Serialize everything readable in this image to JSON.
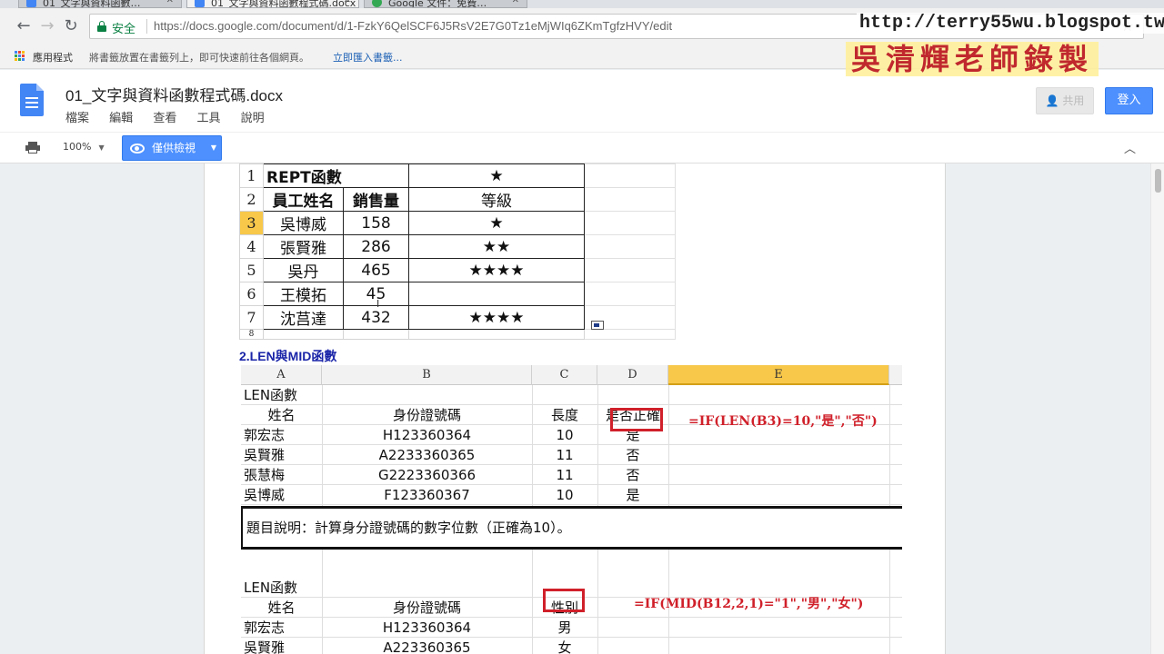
{
  "browser": {
    "tabs": [
      {
        "label": "01_文字與資料函數…"
      },
      {
        "label": "01_文字與資料函數程式碼.docx"
      },
      {
        "label": "Google 文件：免費…"
      }
    ],
    "security_label": "安全",
    "url": "https://docs.google.com/document/d/1-FzkY6QelSCF6J5RsV2E7G0Tz1eMjWIq6ZKmTgfzHVY/edit",
    "bookmarks": {
      "apps_label": "應用程式",
      "hint": "將書籤放置在書籤列上，即可快速前往各個網頁。",
      "import_link": "立即匯入書籤..."
    }
  },
  "watermark": {
    "url": "http://terry55wu.blogspot.tw",
    "name": "吳清輝老師錄製"
  },
  "doc": {
    "title": "01_文字與資料函數程式碼.docx",
    "menu": [
      "檔案",
      "編輯",
      "查看",
      "工具",
      "說明"
    ],
    "share_label": "共用",
    "login_label": "登入",
    "zoom": "100%",
    "view_mode_label": "僅供檢視"
  },
  "rept_table": {
    "title": "REPT函數",
    "title_star": "★",
    "headers": [
      "員工姓名",
      "銷售量",
      "等級"
    ],
    "row_numbers": [
      "1",
      "2",
      "3",
      "4",
      "5",
      "6",
      "7",
      "8"
    ],
    "rows": [
      {
        "name": "吳博威",
        "sales": "158",
        "grade": "★"
      },
      {
        "name": "張賢雅",
        "sales": "286",
        "grade": "★★"
      },
      {
        "name": "吳丹",
        "sales": "465",
        "grade": "★★★★"
      },
      {
        "name": "王模拓",
        "sales": "45",
        "grade": ""
      },
      {
        "name": "沈莒達",
        "sales": "432",
        "grade": "★★★★"
      }
    ]
  },
  "section_title": "2.LEN與MID函數",
  "len_sheet": {
    "column_letters": [
      "A",
      "B",
      "C",
      "D",
      "E"
    ],
    "len_title": "LEN函數",
    "len_headers": [
      "姓名",
      "身份證號碼",
      "長度",
      "是否正確"
    ],
    "len_rows": [
      {
        "name": "郭宏志",
        "id": "H123360364",
        "len": "10",
        "ok": "是"
      },
      {
        "name": "吳賢雅",
        "id": "A2233360365",
        "len": "11",
        "ok": "否"
      },
      {
        "name": "張慧梅",
        "id": "G2223360366",
        "len": "11",
        "ok": "否"
      },
      {
        "name": "吳博威",
        "id": "F123360367",
        "len": "10",
        "ok": "是"
      }
    ],
    "len_formula": "=IF(LEN(B3)=10,\"是\",\"否\")",
    "note": "題目說明：計算身分證號碼的數字位數（正確為10）。",
    "mid_title": "LEN函數",
    "mid_headers": [
      "姓名",
      "身份證號碼",
      "性別"
    ],
    "mid_rows": [
      {
        "name": "郭宏志",
        "id": "H123360364",
        "sex": "男"
      },
      {
        "name": "吳賢雅",
        "id": "A223360365",
        "sex": "女"
      }
    ],
    "mid_formula": "=IF(MID(B12,2,1)=\"1\",\"男\",\"女\")"
  },
  "colors": {
    "accent": "#4d90fe",
    "highlight": "#f7c84a",
    "formula_red": "#d0202a",
    "section_blue": "#1a25a8"
  }
}
